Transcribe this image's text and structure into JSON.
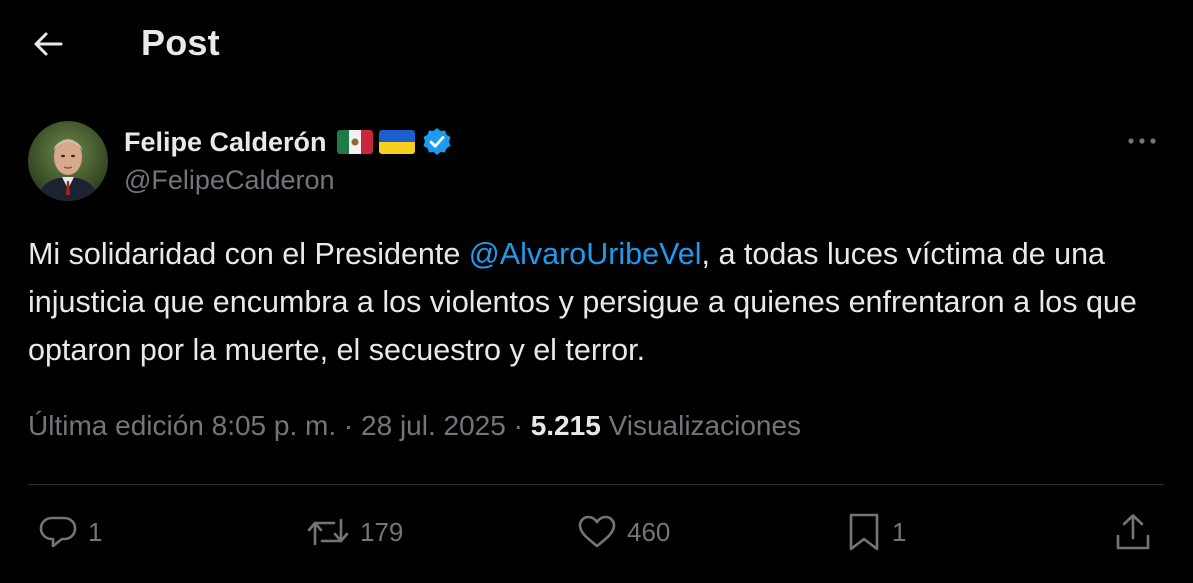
{
  "header": {
    "title": "Post",
    "back_icon": "arrow-left-icon"
  },
  "author": {
    "display_name": "Felipe Calderón",
    "handle": "@FelipeCalderon",
    "flags": [
      "mexico-flag-icon",
      "ukraine-flag-icon"
    ],
    "verified": true
  },
  "tweet": {
    "text_before": "Mi solidaridad con el Presidente ",
    "mention": "@AlvaroUribeVel",
    "text_after": ", a todas luces víctima de una injusticia que encumbra a los violentos y persigue a quienes enfrentaron a los que  optaron por la muerte, el secuestro y el terror."
  },
  "meta": {
    "edited_label": "Última edición 8:05 p. m. · 28 jul. 2025",
    "separator": " · ",
    "views_count": "5.215",
    "views_label": " Visualizaciones"
  },
  "actions": {
    "replies": "1",
    "reposts": "179",
    "likes": "460",
    "bookmarks": "1"
  },
  "colors": {
    "background": "#000000",
    "text": "#e7e9ea",
    "muted": "#71767b",
    "accent": "#1d9bf0",
    "divider": "#2f3336"
  }
}
